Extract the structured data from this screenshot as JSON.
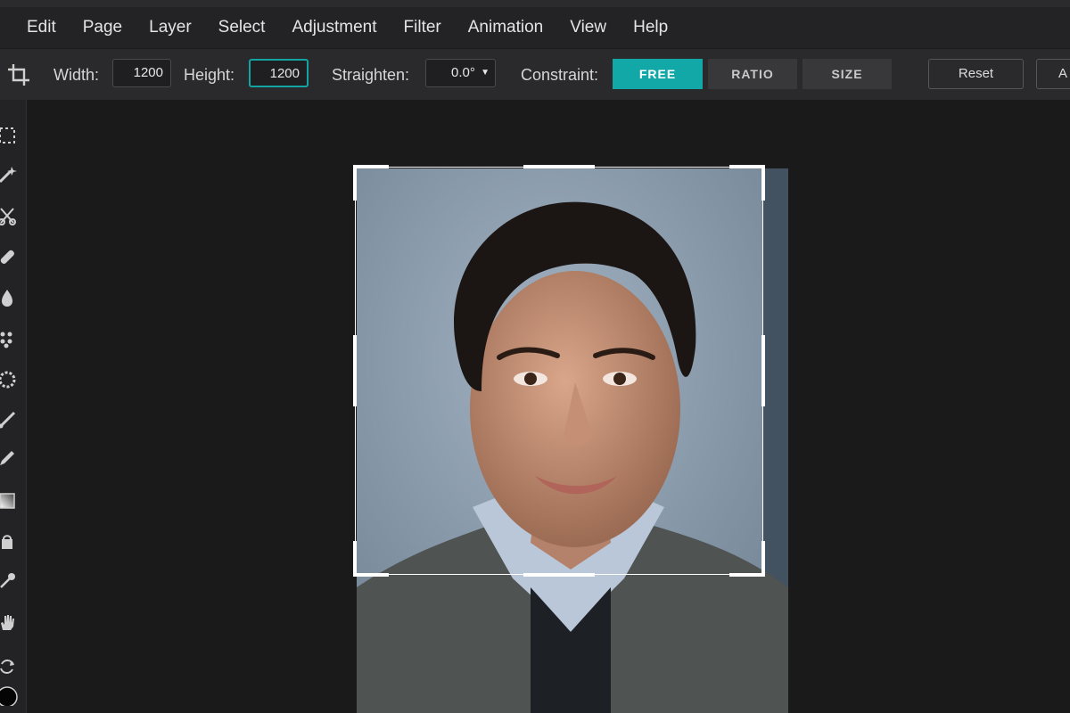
{
  "menu": [
    "Edit",
    "Page",
    "Layer",
    "Select",
    "Adjustment",
    "Filter",
    "Animation",
    "View",
    "Help"
  ],
  "toolbar": {
    "width_label": "Width:",
    "width_value": "1200",
    "height_label": "Height:",
    "height_value": "1200",
    "straighten_label": "Straighten:",
    "straighten_value": "0.0°",
    "constraint_label": "Constraint:",
    "constraint_options": [
      "FREE",
      "RATIO",
      "SIZE"
    ],
    "constraint_selected": "FREE",
    "reset_label": "Reset",
    "apply_label": "A"
  },
  "tools": [
    "marquee-select-icon",
    "magic-wand-icon",
    "scissors-icon",
    "bandage-heal-icon",
    "water-drop-icon",
    "pattern-stamp-icon",
    "sponge-icon",
    "brush-icon",
    "pencil-icon",
    "gradient-icon",
    "paint-bucket-icon",
    "eyedropper-icon",
    "hand-icon",
    "rotate-icon",
    "color-swatch-icon"
  ],
  "colors": {
    "accent": "#13a3a3",
    "menu_bg": "#232325",
    "toolbar_bg": "#2a2a2c",
    "canvas_bg": "#1a1a1b"
  }
}
